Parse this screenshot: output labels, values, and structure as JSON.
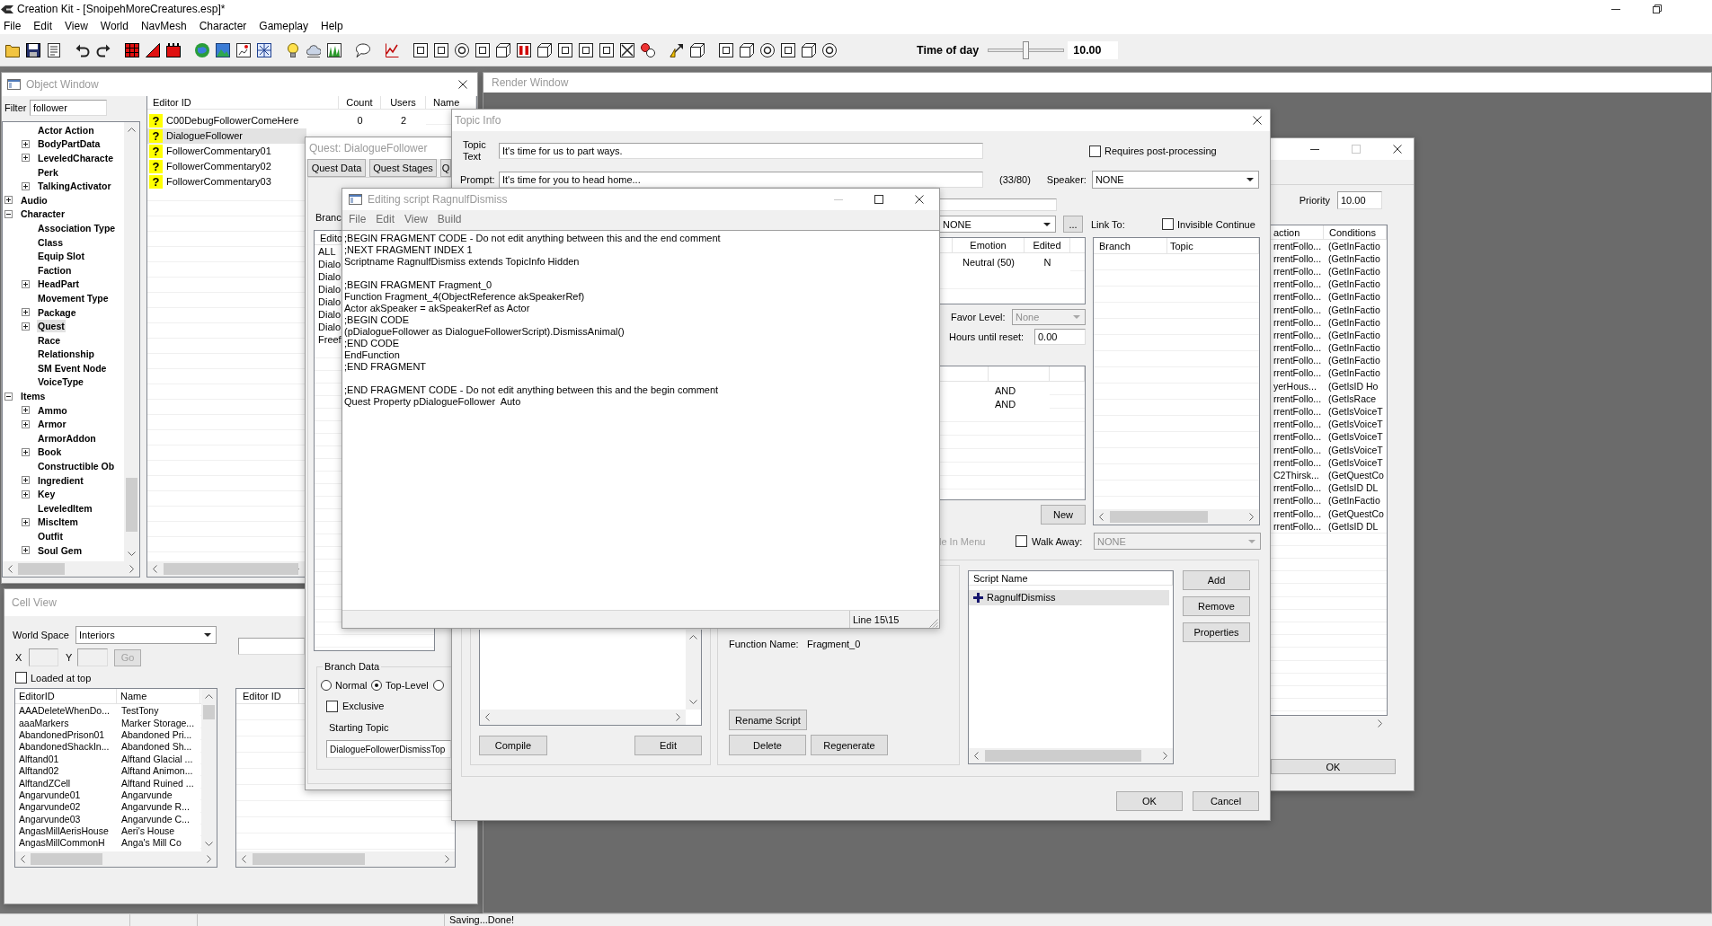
{
  "app": {
    "title": "Creation Kit - [SnoipehMoreCreatures.esp]*",
    "menu": [
      "File",
      "Edit",
      "View",
      "World",
      "NavMesh",
      "Character",
      "Gameplay",
      "Help"
    ]
  },
  "toolbar": {
    "time_of_day": {
      "label": "Time of day",
      "level": 0.5,
      "reading": "10.00"
    }
  },
  "object_window": {
    "title": "Object Window",
    "filter": {
      "label": "Filter",
      "value": "follower"
    },
    "tree": {
      "partial_branch": [
        {
          "label": "Actor Action",
          "kind": "leaf",
          "expanded": false,
          "selected": false
        },
        {
          "label": "BodyPartData",
          "kind": "branch",
          "expanded": false,
          "selected": false
        },
        {
          "label": "LeveledCharacte",
          "kind": "branch",
          "expanded": false,
          "selected": false
        },
        {
          "label": "Perk",
          "kind": "leaf",
          "expanded": false,
          "selected": false
        },
        {
          "label": "TalkingActivator",
          "kind": "branch",
          "expanded": false,
          "selected": false
        }
      ],
      "items": [
        {
          "label": "Audio",
          "kind": "branch",
          "expanded": false,
          "selected": false
        },
        {
          "label": "Character",
          "kind": "branch",
          "expanded": true,
          "selected": false,
          "children": [
            {
              "label": "Association Type",
              "kind": "leaf",
              "expanded": false,
              "selected": false
            },
            {
              "label": "Class",
              "kind": "leaf",
              "expanded": false,
              "selected": false
            },
            {
              "label": "Equip Slot",
              "kind": "leaf",
              "expanded": false,
              "selected": false
            },
            {
              "label": "Faction",
              "kind": "leaf",
              "expanded": false,
              "selected": false
            },
            {
              "label": "HeadPart",
              "kind": "branch",
              "expanded": false,
              "selected": false
            },
            {
              "label": "Movement Type",
              "kind": "leaf",
              "expanded": false,
              "selected": false
            },
            {
              "label": "Package",
              "kind": "branch",
              "expanded": false,
              "selected": false
            },
            {
              "label": "Quest",
              "kind": "branch",
              "expanded": false,
              "selected": true
            },
            {
              "label": "Race",
              "kind": "leaf",
              "expanded": false,
              "selected": false
            },
            {
              "label": "Relationship",
              "kind": "leaf",
              "expanded": false,
              "selected": false
            },
            {
              "label": "SM Event Node",
              "kind": "leaf",
              "expanded": false,
              "selected": false
            },
            {
              "label": "VoiceType",
              "kind": "leaf",
              "expanded": false,
              "selected": false
            }
          ]
        },
        {
          "label": "Items",
          "kind": "branch",
          "expanded": true,
          "selected": false,
          "children": [
            {
              "label": "Ammo",
              "kind": "branch",
              "expanded": false,
              "selected": false
            },
            {
              "label": "Armor",
              "kind": "branch",
              "expanded": false,
              "selected": false
            },
            {
              "label": "ArmorAddon",
              "kind": "leaf",
              "expanded": false,
              "selected": false
            },
            {
              "label": "Book",
              "kind": "branch",
              "expanded": false,
              "selected": false
            },
            {
              "label": "Constructible Ob",
              "kind": "leaf",
              "expanded": false,
              "selected": false
            },
            {
              "label": "Ingredient",
              "kind": "branch",
              "expanded": false,
              "selected": false
            },
            {
              "label": "Key",
              "kind": "branch",
              "expanded": false,
              "selected": false
            },
            {
              "label": "LeveledItem",
              "kind": "leaf",
              "expanded": false,
              "selected": false
            },
            {
              "label": "MiscItem",
              "kind": "branch",
              "expanded": false,
              "selected": false
            },
            {
              "label": "Outfit",
              "kind": "leaf",
              "expanded": false,
              "selected": false
            },
            {
              "label": "Soul Gem",
              "kind": "branch",
              "expanded": false,
              "selected": false
            }
          ]
        }
      ]
    },
    "list": {
      "columns": [
        "Editor ID",
        "Count",
        "Users",
        "Name"
      ],
      "rows": [
        {
          "marker": "?",
          "editor_id": "C00DebugFollowerComeHere",
          "count": "0",
          "users": "2",
          "selected": false
        },
        {
          "marker": "?",
          "editor_id": "DialogueFollower",
          "selected": true
        },
        {
          "marker": "?",
          "editor_id": "FollowerCommentary01",
          "selected": false
        },
        {
          "marker": "?",
          "editor_id": "FollowerCommentary02",
          "selected": false
        },
        {
          "marker": "?",
          "editor_id": "FollowerCommentary03",
          "selected": false
        }
      ]
    }
  },
  "render_window": {
    "title": "Render Window"
  },
  "cell_view": {
    "title": "Cell View",
    "world_space": {
      "label": "World Space",
      "value": "Interiors"
    },
    "coordinates": {
      "x_label": "X",
      "y_label": "Y",
      "disabled": true
    },
    "go_button": {
      "label": "Go",
      "disabled": true
    },
    "loaded_at_top": {
      "label": "Loaded at top",
      "checked": false
    },
    "cells": {
      "columns": [
        "EditorID",
        "Name"
      ],
      "rows": [
        [
          "AAADeleteWhenDo...",
          "TestTony"
        ],
        [
          "aaaMarkers",
          "Marker Storage..."
        ],
        [
          "AbandonedPrison01",
          "Abandoned Pri..."
        ],
        [
          "AbandonedShackIn...",
          "Abandoned Sh..."
        ],
        [
          "Alftand01",
          "Alftand Glacial ..."
        ],
        [
          "Alftand02",
          "Alftand Animon..."
        ],
        [
          "AlftandZCell",
          "Alftand Ruined ..."
        ],
        [
          "Angarvunde01",
          "Angarvunde"
        ],
        [
          "Angarvunde02",
          "Angarvunde R..."
        ],
        [
          "Angarvunde03",
          "Angarvunde C..."
        ],
        [
          "AngasMillAerisHouse",
          "Aeri's House"
        ],
        [
          "AngasMillCommonH",
          "Anga's Mill Co"
        ]
      ]
    },
    "references": {
      "columns": [
        "Editor ID"
      ]
    }
  },
  "quest_window": {
    "title": "Quest: DialogueFollower",
    "tabs": [
      {
        "label": "Quest Data",
        "selected": false
      },
      {
        "label": "Quest Stages",
        "selected": false
      },
      {
        "label": "Q",
        "selected": false
      }
    ],
    "branches_label": "Branc",
    "branch_list": {
      "columns": [
        "Edito"
      ],
      "rows": [
        "ALL",
        "Dialo",
        "Dialo",
        "Dialo",
        "Dialo",
        "Dialo",
        "Dialo",
        "Freef"
      ]
    },
    "branch_data": {
      "title": "Branch Data",
      "types": [
        {
          "label": "Normal",
          "selected": false
        },
        {
          "label": "Top-Level",
          "selected": true
        },
        {
          "selected": false
        }
      ],
      "exclusive": {
        "label": "Exclusive",
        "checked": false
      },
      "starting_topic": {
        "label": "Starting Topic",
        "value": "DialogueFollowerDismissTop"
      }
    }
  },
  "topic_info": {
    "title": "Topic Info",
    "topic_text": {
      "label": "Topic Text",
      "value": "It's time for us to part ways."
    },
    "requires_post_processing": {
      "label": "Requires post-processing",
      "checked": false
    },
    "prompt": {
      "label": "Prompt:",
      "value": "It's time for you to head home...",
      "counter": "(33/80)"
    },
    "speaker": {
      "label": "Speaker:",
      "value": "NONE"
    },
    "response": {
      "value": "NONE",
      "more_button": "..."
    },
    "link_to": "Link To:",
    "invisible_continue": {
      "label": "Invisible Continue",
      "checked": false
    },
    "responses": {
      "columns": [
        "Emotion",
        "Edited"
      ],
      "rows": [
        {
          "emotion": "Neutral (50)",
          "edited": "N"
        }
      ]
    },
    "favor_level": {
      "label": "Favor Level:",
      "value": "None",
      "disabled": true
    },
    "hours_until_reset": {
      "label": "Hours until reset:",
      "value": "0.00"
    },
    "conditions": {
      "rows": [
        "AND",
        "AND"
      ]
    },
    "new_button": "New",
    "link_list": {
      "columns": [
        "Branch",
        "Topic"
      ]
    },
    "visible_in_menu": {
      "label": "le In Menu",
      "disabled": true
    },
    "walk_away": {
      "label": "Walk Away:",
      "checked": false,
      "value": "NONE",
      "disabled": true
    },
    "fragment": {
      "compile_button": "Compile",
      "edit_button": "Edit",
      "function_label": "Function Name:",
      "function_name": "Fragment_0",
      "rename_button": "Rename Script",
      "delete_button": "Delete",
      "regenerate_button": "Regenerate"
    },
    "scripts": {
      "column": "Script Name",
      "rows": [
        {
          "name": "RagnulfDismiss",
          "selected": true
        }
      ],
      "buttons": [
        "Add",
        "Remove",
        "Properties"
      ]
    },
    "buttons": [
      "OK",
      "Cancel"
    ]
  },
  "side_window": {
    "priority": {
      "label": "Priority",
      "value": "10.00"
    },
    "conditions": {
      "columns": [
        "action",
        "Conditions"
      ],
      "rows": [
        [
          "rrentFollo...",
          "(GetInFactio"
        ],
        [
          "rrentFollo...",
          "(GetInFactio"
        ],
        [
          "rrentFollo...",
          "(GetInFactio"
        ],
        [
          "rrentFollo...",
          "(GetInFactio"
        ],
        [
          "rrentFollo...",
          "(GetInFactio"
        ],
        [
          "rrentFollo...",
          "(GetInFactio"
        ],
        [
          "rrentFollo...",
          "(GetInFactio"
        ],
        [
          "rrentFollo...",
          "(GetInFactio"
        ],
        [
          "rrentFollo...",
          "(GetInFactio"
        ],
        [
          "rrentFollo...",
          "(GetInFactio"
        ],
        [
          "rrentFollo...",
          "(GetInFactio"
        ],
        [
          "yerHous...",
          "(GetIsID Ho"
        ],
        [
          "rrentFollo...",
          "(GetIsRace"
        ],
        [
          "rrentFollo...",
          "(GetIsVoiceT"
        ],
        [
          "rrentFollo...",
          "(GetIsVoiceT"
        ],
        [
          "rrentFollo...",
          "(GetIsVoiceT"
        ],
        [
          "rrentFollo...",
          "(GetIsVoiceT"
        ],
        [
          "rrentFollo...",
          "(GetIsVoiceT"
        ],
        [
          "C2Thirsk...",
          "(GetQuestCo"
        ],
        [
          "rrentFollo...",
          "(GetIsID DL"
        ],
        [
          "rrentFollo...",
          "(GetInFactio"
        ],
        [
          "rrentFollo...",
          "(GetQuestCo"
        ],
        [
          "rrentFollo...",
          "(GetIsID DL"
        ]
      ]
    },
    "ok_button": "OK"
  },
  "script_editor": {
    "title": "Editing script RagnulfDismiss",
    "menu": [
      "File",
      "Edit",
      "View",
      "Build"
    ],
    "code": ";BEGIN FRAGMENT CODE - Do not edit anything between this and the end comment\n;NEXT FRAGMENT INDEX 1\nScriptname RagnulfDismiss extends TopicInfo Hidden\n\n;BEGIN FRAGMENT Fragment_0\nFunction Fragment_4(ObjectReference akSpeakerRef)\nActor akSpeaker = akSpeakerRef as Actor\n;BEGIN CODE\n(pDialogueFollower as DialogueFollowerScript).DismissAnimal()\n;END CODE\nEndFunction\n;END FRAGMENT\n\n;END FRAGMENT CODE - Do not edit anything between this and the begin comment\nQuest Property pDialogueFollower  Auto",
    "status": "Line 15\\15"
  },
  "status_bar": {
    "message": "Saving...Done!"
  }
}
